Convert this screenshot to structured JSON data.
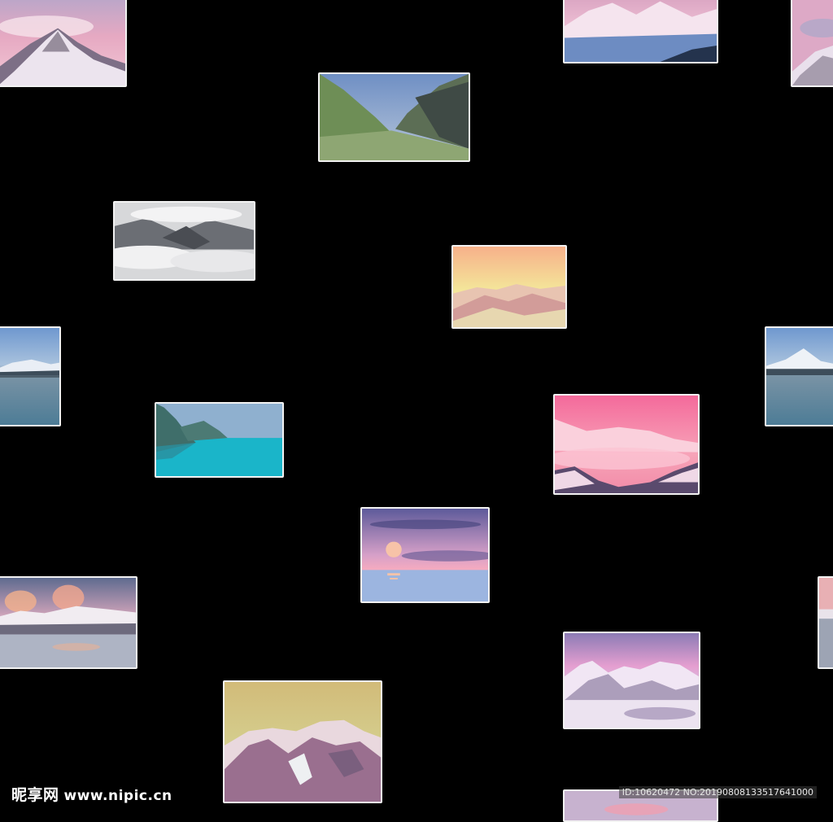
{
  "background_color": "#000000",
  "frame_color": "#f2f2f2",
  "photos": [
    {
      "name": "photo-snow-peak-pink-clouds",
      "subject": "snow-capped peak under pink sky"
    },
    {
      "name": "photo-mountain-pink-sky-topright",
      "subject": "snowy mountains with pink sky and blue base"
    },
    {
      "name": "photo-edge-snowy-pink",
      "subject": "snowy mountain at right edge"
    },
    {
      "name": "photo-green-valley",
      "subject": "green mountain valley with blue sky"
    },
    {
      "name": "photo-grey-clouds-mountains",
      "subject": "mountains above a sea of clouds, grey tones"
    },
    {
      "name": "photo-yellow-sky-mountains",
      "subject": "snowy mountains under yellow sky"
    },
    {
      "name": "photo-lake-left-edge",
      "subject": "lake with snowy mountain, blue tones"
    },
    {
      "name": "photo-lake-right-edge",
      "subject": "lake with snowy mountain, blue tones"
    },
    {
      "name": "photo-turquoise-sea-cliffs",
      "subject": "cliffs above turquoise sea"
    },
    {
      "name": "photo-pink-clouds-mountains",
      "subject": "pink sea of clouds with mountains"
    },
    {
      "name": "photo-sunset-sea",
      "subject": "sunset over sea with purple clouds"
    },
    {
      "name": "photo-snow-lake-sunset",
      "subject": "snowy mountains and lake at sunset"
    },
    {
      "name": "photo-edge-right-small",
      "subject": "partial photo at right edge"
    },
    {
      "name": "photo-violet-snow-mountains",
      "subject": "violet sky over snowy mountains and frozen lake"
    },
    {
      "name": "photo-khaki-rocky-mountain",
      "subject": "rocky mountain under khaki sky"
    },
    {
      "name": "photo-bottom-partial",
      "subject": "partial photo at bottom edge"
    }
  ],
  "watermark": {
    "site_cn": "昵享网",
    "site_url": "www.nipic.cn",
    "id_text": "ID:10620472 NO:20190808133517641000"
  }
}
